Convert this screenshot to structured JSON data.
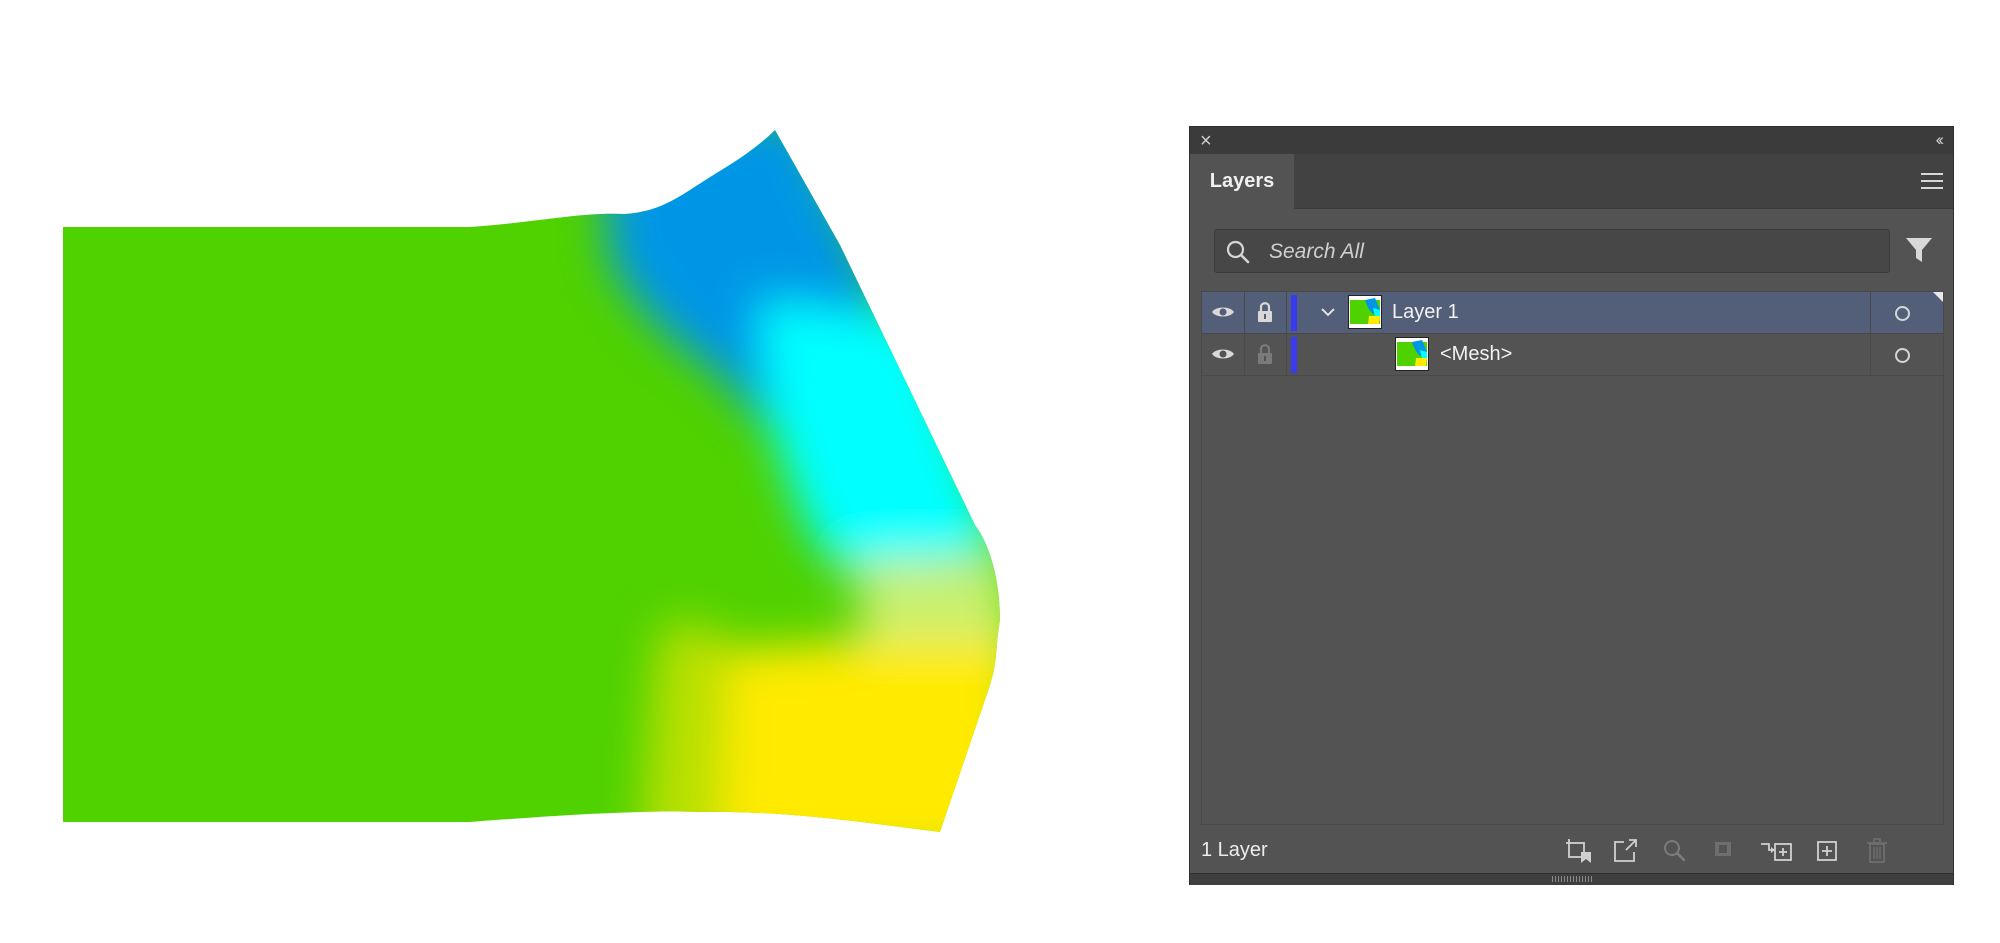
{
  "artwork": {
    "colors": {
      "green": "#4fd200",
      "blue": "#0096e6",
      "cyan": "#00ffff",
      "yellow": "#ffea00"
    }
  },
  "panel": {
    "close_icon": "close-icon",
    "collapse_icon": "collapse-icon",
    "collapse_glyph": "‹‹",
    "tab_label": "Layers",
    "menu_icon": "hamburger-menu-icon",
    "search": {
      "placeholder": "Search All",
      "icon": "search-icon"
    },
    "filter_icon": "filter-icon",
    "layers": [
      {
        "name": "Layer 1",
        "visible": true,
        "locked_icon": "lock-icon",
        "expanded": true,
        "selected": true,
        "color": "#3a3af0"
      },
      {
        "name": "<Mesh>",
        "visible": true,
        "locked_icon": "lock-icon",
        "selected": false,
        "color": "#3a3af0"
      }
    ],
    "footer": {
      "count_label": "1 Layer",
      "tools": [
        "collect-for-export-icon",
        "export-icon",
        "locate-object-icon",
        "make-clipping-mask-icon",
        "create-sublayer-icon",
        "create-new-layer-icon",
        "delete-icon"
      ]
    },
    "colors": {
      "panel_bg": "#535353",
      "selected_row": "#535f78",
      "accent": "#3a3af0"
    }
  }
}
